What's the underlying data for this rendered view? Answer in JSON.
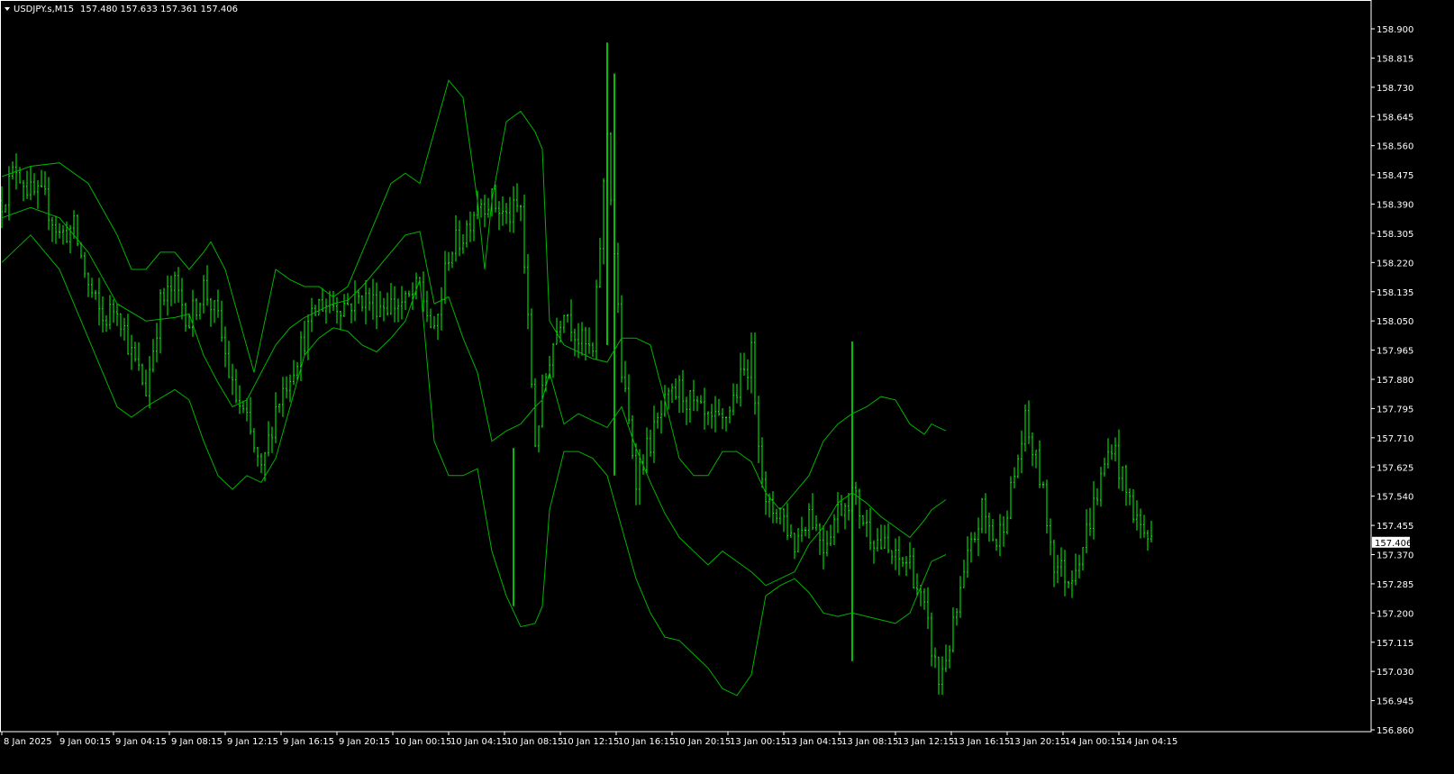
{
  "header": {
    "symbol": "USDJPY.s,M15",
    "ohlc": "157.480 157.633 157.361 157.406"
  },
  "colors": {
    "background": "#000000",
    "frame": "#ffffff",
    "candle": "#00ff00",
    "bands": "#00b300",
    "text": "#ffffff"
  },
  "chart_data": {
    "type": "line",
    "subtype": "price-chart (bars) with Bollinger Bands",
    "title": "USDJPY.s,M15",
    "xlabel": "",
    "ylabel": "",
    "ylim": [
      156.86,
      158.96
    ],
    "y_ticks": [
      "158.900",
      "158.815",
      "158.730",
      "158.645",
      "158.560",
      "158.475",
      "158.390",
      "158.305",
      "158.220",
      "158.135",
      "158.050",
      "157.965",
      "157.880",
      "157.795",
      "157.710",
      "157.625",
      "157.540",
      "157.455",
      "157.370",
      "157.285",
      "157.200",
      "157.115",
      "157.030",
      "156.945",
      "156.860"
    ],
    "current_price": "157.406",
    "x_ticks": [
      "8 Jan 2025",
      "9 Jan 00:15",
      "9 Jan 04:15",
      "9 Jan 08:15",
      "9 Jan 12:15",
      "9 Jan 16:15",
      "9 Jan 20:15",
      "10 Jan 00:15",
      "10 Jan 04:15",
      "10 Jan 08:15",
      "10 Jan 12:15",
      "10 Jan 16:15",
      "10 Jan 20:15",
      "13 Jan 00:15",
      "13 Jan 04:15",
      "13 Jan 08:15",
      "13 Jan 12:15",
      "13 Jan 16:15",
      "13 Jan 20:15",
      "14 Jan 00:15",
      "14 Jan 04:15"
    ],
    "bars_total": 320,
    "close_path": [
      [
        0,
        158.4
      ],
      [
        4,
        158.5
      ],
      [
        8,
        158.42
      ],
      [
        12,
        158.4
      ],
      [
        16,
        158.3
      ],
      [
        20,
        158.32
      ],
      [
        24,
        158.15
      ],
      [
        28,
        158.05
      ],
      [
        32,
        158.1
      ],
      [
        36,
        157.95
      ],
      [
        40,
        157.85
      ],
      [
        44,
        158.1
      ],
      [
        48,
        158.15
      ],
      [
        52,
        158.05
      ],
      [
        56,
        158.15
      ],
      [
        60,
        158.05
      ],
      [
        64,
        157.85
      ],
      [
        68,
        157.75
      ],
      [
        72,
        157.6
      ],
      [
        76,
        157.8
      ],
      [
        80,
        157.9
      ],
      [
        84,
        158.0
      ],
      [
        88,
        158.1
      ],
      [
        92,
        158.1
      ],
      [
        96,
        158.1
      ],
      [
        100,
        158.12
      ],
      [
        104,
        158.1
      ],
      [
        108,
        158.1
      ],
      [
        112,
        158.1
      ],
      [
        116,
        158.15
      ],
      [
        120,
        158.0
      ],
      [
        124,
        158.25
      ],
      [
        128,
        158.3
      ],
      [
        132,
        158.4
      ],
      [
        136,
        158.4
      ],
      [
        140,
        158.35
      ],
      [
        144,
        158.38
      ],
      [
        148,
        157.7
      ],
      [
        152,
        157.95
      ],
      [
        156,
        158.1
      ],
      [
        160,
        158.0
      ],
      [
        164,
        157.95
      ],
      [
        168,
        158.6
      ],
      [
        172,
        157.9
      ],
      [
        176,
        157.6
      ],
      [
        180,
        157.7
      ],
      [
        184,
        157.8
      ],
      [
        188,
        157.85
      ],
      [
        192,
        157.8
      ],
      [
        196,
        157.75
      ],
      [
        200,
        157.75
      ],
      [
        204,
        157.85
      ],
      [
        208,
        157.95
      ],
      [
        212,
        157.5
      ],
      [
        216,
        157.5
      ],
      [
        220,
        157.4
      ],
      [
        224,
        157.5
      ],
      [
        228,
        157.4
      ],
      [
        232,
        157.5
      ],
      [
        236,
        157.55
      ],
      [
        240,
        157.45
      ],
      [
        244,
        157.4
      ],
      [
        248,
        157.35
      ],
      [
        252,
        157.35
      ],
      [
        256,
        157.2
      ],
      [
        260,
        157.0
      ],
      [
        264,
        157.15
      ],
      [
        268,
        157.35
      ],
      [
        272,
        157.5
      ],
      [
        276,
        157.4
      ],
      [
        280,
        157.55
      ],
      [
        284,
        157.75
      ],
      [
        288,
        157.6
      ],
      [
        292,
        157.35
      ],
      [
        296,
        157.3
      ],
      [
        300,
        157.4
      ],
      [
        304,
        157.55
      ],
      [
        308,
        157.7
      ],
      [
        312,
        157.55
      ],
      [
        316,
        157.45
      ],
      [
        319,
        157.406
      ]
    ],
    "bollinger_upper": [
      [
        0,
        158.47
      ],
      [
        8,
        158.5
      ],
      [
        16,
        158.51
      ],
      [
        24,
        158.45
      ],
      [
        32,
        158.3
      ],
      [
        36,
        158.2
      ],
      [
        40,
        158.2
      ],
      [
        44,
        158.25
      ],
      [
        48,
        158.25
      ],
      [
        52,
        158.2
      ],
      [
        56,
        158.25
      ],
      [
        58,
        158.28
      ],
      [
        62,
        158.2
      ],
      [
        66,
        158.05
      ],
      [
        70,
        157.9
      ],
      [
        74,
        158.1
      ],
      [
        76,
        158.2
      ],
      [
        80,
        158.17
      ],
      [
        84,
        158.15
      ],
      [
        88,
        158.15
      ],
      [
        92,
        158.12
      ],
      [
        96,
        158.15
      ],
      [
        100,
        158.25
      ],
      [
        104,
        158.35
      ],
      [
        108,
        158.45
      ],
      [
        112,
        158.48
      ],
      [
        116,
        158.45
      ],
      [
        120,
        158.6
      ],
      [
        124,
        158.75
      ],
      [
        128,
        158.7
      ],
      [
        132,
        158.4
      ],
      [
        134,
        158.2
      ],
      [
        136,
        158.4
      ],
      [
        140,
        158.63
      ],
      [
        144,
        158.66
      ],
      [
        148,
        158.6
      ],
      [
        150,
        158.55
      ],
      [
        152,
        158.05
      ],
      [
        156,
        157.98
      ],
      [
        160,
        157.96
      ],
      [
        164,
        157.94
      ],
      [
        168,
        157.93
      ],
      [
        172,
        158.0
      ],
      [
        176,
        158.0
      ],
      [
        180,
        157.98
      ],
      [
        184,
        157.82
      ],
      [
        188,
        157.65
      ],
      [
        192,
        157.6
      ],
      [
        196,
        157.6
      ],
      [
        200,
        157.67
      ],
      [
        204,
        157.67
      ],
      [
        208,
        157.64
      ],
      [
        212,
        157.55
      ],
      [
        216,
        157.5
      ],
      [
        220,
        157.55
      ],
      [
        224,
        157.6
      ],
      [
        228,
        157.7
      ],
      [
        232,
        157.75
      ],
      [
        236,
        157.78
      ],
      [
        240,
        157.8
      ],
      [
        244,
        157.83
      ],
      [
        248,
        157.82
      ],
      [
        252,
        157.75
      ],
      [
        256,
        157.72
      ],
      [
        258,
        157.75
      ],
      [
        262,
        157.73
      ]
    ],
    "bollinger_middle": [
      [
        0,
        158.35
      ],
      [
        8,
        158.38
      ],
      [
        16,
        158.35
      ],
      [
        24,
        158.25
      ],
      [
        32,
        158.1
      ],
      [
        40,
        158.05
      ],
      [
        48,
        158.06
      ],
      [
        52,
        158.07
      ],
      [
        56,
        157.95
      ],
      [
        60,
        157.87
      ],
      [
        64,
        157.8
      ],
      [
        68,
        157.82
      ],
      [
        72,
        157.9
      ],
      [
        76,
        157.98
      ],
      [
        80,
        158.03
      ],
      [
        84,
        158.06
      ],
      [
        88,
        158.08
      ],
      [
        92,
        158.1
      ],
      [
        96,
        158.11
      ],
      [
        100,
        158.15
      ],
      [
        104,
        158.2
      ],
      [
        108,
        158.25
      ],
      [
        112,
        158.3
      ],
      [
        116,
        158.31
      ],
      [
        120,
        158.1
      ],
      [
        124,
        158.12
      ],
      [
        128,
        158.0
      ],
      [
        132,
        157.9
      ],
      [
        136,
        157.7
      ],
      [
        140,
        157.73
      ],
      [
        144,
        157.75
      ],
      [
        148,
        157.8
      ],
      [
        150,
        157.82
      ],
      [
        152,
        157.9
      ],
      [
        156,
        157.75
      ],
      [
        160,
        157.78
      ],
      [
        164,
        157.76
      ],
      [
        168,
        157.74
      ],
      [
        172,
        157.8
      ],
      [
        176,
        157.68
      ],
      [
        180,
        157.58
      ],
      [
        184,
        157.49
      ],
      [
        188,
        157.42
      ],
      [
        192,
        157.38
      ],
      [
        196,
        157.34
      ],
      [
        200,
        157.38
      ],
      [
        204,
        157.35
      ],
      [
        208,
        157.32
      ],
      [
        212,
        157.28
      ],
      [
        216,
        157.3
      ],
      [
        220,
        157.32
      ],
      [
        224,
        157.4
      ],
      [
        228,
        157.45
      ],
      [
        232,
        157.52
      ],
      [
        236,
        157.55
      ],
      [
        240,
        157.52
      ],
      [
        244,
        157.48
      ],
      [
        248,
        157.45
      ],
      [
        252,
        157.42
      ],
      [
        256,
        157.47
      ],
      [
        258,
        157.5
      ],
      [
        262,
        157.53
      ]
    ],
    "bollinger_lower": [
      [
        0,
        158.22
      ],
      [
        8,
        158.3
      ],
      [
        16,
        158.2
      ],
      [
        24,
        158.0
      ],
      [
        32,
        157.8
      ],
      [
        36,
        157.77
      ],
      [
        40,
        157.8
      ],
      [
        48,
        157.85
      ],
      [
        52,
        157.82
      ],
      [
        56,
        157.7
      ],
      [
        60,
        157.6
      ],
      [
        64,
        157.56
      ],
      [
        68,
        157.6
      ],
      [
        72,
        157.58
      ],
      [
        76,
        157.65
      ],
      [
        80,
        157.8
      ],
      [
        84,
        157.95
      ],
      [
        88,
        158.0
      ],
      [
        92,
        158.03
      ],
      [
        96,
        158.02
      ],
      [
        100,
        157.98
      ],
      [
        104,
        157.96
      ],
      [
        108,
        158.0
      ],
      [
        112,
        158.05
      ],
      [
        116,
        158.17
      ],
      [
        120,
        157.7
      ],
      [
        124,
        157.6
      ],
      [
        128,
        157.6
      ],
      [
        132,
        157.62
      ],
      [
        136,
        157.38
      ],
      [
        140,
        157.25
      ],
      [
        144,
        157.16
      ],
      [
        148,
        157.17
      ],
      [
        150,
        157.22
      ],
      [
        152,
        157.5
      ],
      [
        156,
        157.67
      ],
      [
        160,
        157.67
      ],
      [
        164,
        157.65
      ],
      [
        168,
        157.6
      ],
      [
        172,
        157.45
      ],
      [
        176,
        157.3
      ],
      [
        180,
        157.2
      ],
      [
        184,
        157.13
      ],
      [
        188,
        157.12
      ],
      [
        192,
        157.08
      ],
      [
        196,
        157.04
      ],
      [
        200,
        156.98
      ],
      [
        204,
        156.96
      ],
      [
        208,
        157.02
      ],
      [
        212,
        157.25
      ],
      [
        216,
        157.28
      ],
      [
        220,
        157.3
      ],
      [
        224,
        157.26
      ],
      [
        228,
        157.2
      ],
      [
        232,
        157.19
      ],
      [
        236,
        157.2
      ],
      [
        240,
        157.19
      ],
      [
        244,
        157.18
      ],
      [
        248,
        157.17
      ],
      [
        252,
        157.2
      ],
      [
        256,
        157.3
      ],
      [
        258,
        157.35
      ],
      [
        262,
        157.37
      ]
    ],
    "spikes": [
      [
        168,
        158.86,
        157.98
      ],
      [
        170,
        158.77,
        157.6
      ],
      [
        236,
        157.99,
        157.06
      ],
      [
        142,
        157.68,
        157.22
      ]
    ],
    "grid": false,
    "legend": "none"
  }
}
